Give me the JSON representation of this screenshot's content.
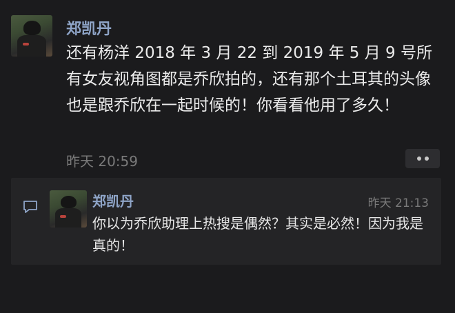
{
  "post": {
    "author": "郑凯丹",
    "content": "还有杨洋 2018 年 3 月 22 到 2019 年 5 月 9 号所有女友视角图都是乔欣拍的，还有那个土耳其的头像也是跟乔欣在一起时候的！你看看他用了多久！",
    "timestamp": "昨天 20:59"
  },
  "comment": {
    "author": "郑凯丹",
    "timestamp": "昨天 21:13",
    "text": "你以为乔欣助理上热搜是偶然？其实是必然！因为我是真的！"
  },
  "colors": {
    "background": "#1b1b1d",
    "name": "#8fa5c8",
    "text": "#ebebeb",
    "muted": "#7a7a7a",
    "comment_bg": "#242426"
  },
  "icons": {
    "more": "more-dots-icon",
    "comment": "comment-icon"
  }
}
